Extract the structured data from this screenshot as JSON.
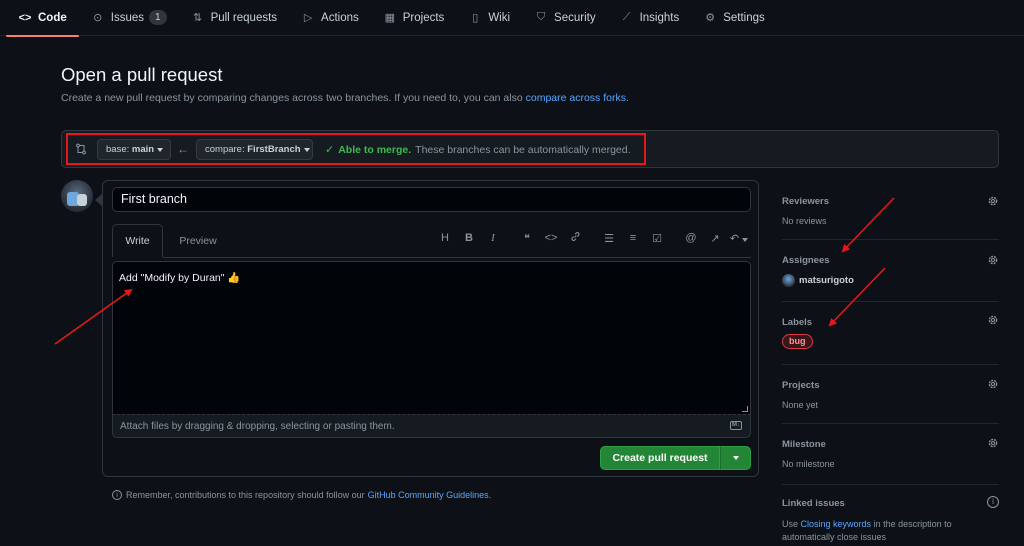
{
  "nav": {
    "items": [
      {
        "label": "Code",
        "icon": "code-icon",
        "active": true
      },
      {
        "label": "Issues",
        "icon": "issue-icon",
        "count": "1"
      },
      {
        "label": "Pull requests",
        "icon": "pull-request-icon"
      },
      {
        "label": "Actions",
        "icon": "play-icon"
      },
      {
        "label": "Projects",
        "icon": "table-icon"
      },
      {
        "label": "Wiki",
        "icon": "book-icon"
      },
      {
        "label": "Security",
        "icon": "shield-icon"
      },
      {
        "label": "Insights",
        "icon": "graph-icon"
      },
      {
        "label": "Settings",
        "icon": "gear-icon"
      }
    ]
  },
  "page": {
    "title": "Open a pull request",
    "subtitle": "Create a new pull request by comparing changes across two branches. If you need to, you can also",
    "subtitle_link": "compare across forks",
    "subtitle_end": "."
  },
  "compare": {
    "base_prefix": "base:",
    "base_value": "main",
    "compare_prefix": "compare:",
    "compare_value": "FirstBranch",
    "merge_status": "Able to merge.",
    "merge_detail": "These branches can be automatically merged."
  },
  "composer": {
    "title_value": "First branch",
    "tab_write": "Write",
    "tab_preview": "Preview",
    "body_text": "Add \"Modify by Duran\" 👍",
    "attach_hint": "Attach files by dragging & dropping, selecting or pasting them.",
    "markdown_badge": "M↓",
    "create_button": "Create pull request"
  },
  "toolbar": {
    "tools": [
      {
        "name": "heading-icon",
        "glyph": "H"
      },
      {
        "name": "bold-icon",
        "glyph": "B"
      },
      {
        "name": "italic-icon",
        "glyph": "I"
      },
      {
        "name": "quote-icon",
        "glyph": "❝"
      },
      {
        "name": "code-icon",
        "glyph": "<>"
      },
      {
        "name": "link-icon",
        "glyph": "🔗"
      },
      {
        "name": "bulleted-list-icon",
        "glyph": "☰"
      },
      {
        "name": "numbered-list-icon",
        "glyph": "≡"
      },
      {
        "name": "task-list-icon",
        "glyph": "☑"
      },
      {
        "name": "mention-icon",
        "glyph": "@"
      },
      {
        "name": "cross-reference-icon",
        "glyph": "↗"
      },
      {
        "name": "saved-replies-icon",
        "glyph": "↶"
      }
    ]
  },
  "remember": {
    "text": "Remember, contributions to this repository should follow our",
    "link": "GitHub Community Guidelines",
    "end": "."
  },
  "sidebar": {
    "reviewers": {
      "title": "Reviewers",
      "value": "No reviews"
    },
    "assignees": {
      "title": "Assignees",
      "value": "matsurigoto"
    },
    "labels": {
      "title": "Labels",
      "value": "bug"
    },
    "projects": {
      "title": "Projects",
      "value": "None yet"
    },
    "milestone": {
      "title": "Milestone",
      "value": "No milestone"
    },
    "linked_issues": {
      "title": "Linked issues",
      "text_before": "Use",
      "link": "Closing keywords",
      "text_after": "in the description to automatically close issues"
    }
  },
  "colors": {
    "background": "#0d1117",
    "accent_green": "#238636",
    "link_blue": "#58a6ff",
    "annotation_red": "#e5171b",
    "label_bug": "#d73a49",
    "tab_underline": "#f78166"
  }
}
